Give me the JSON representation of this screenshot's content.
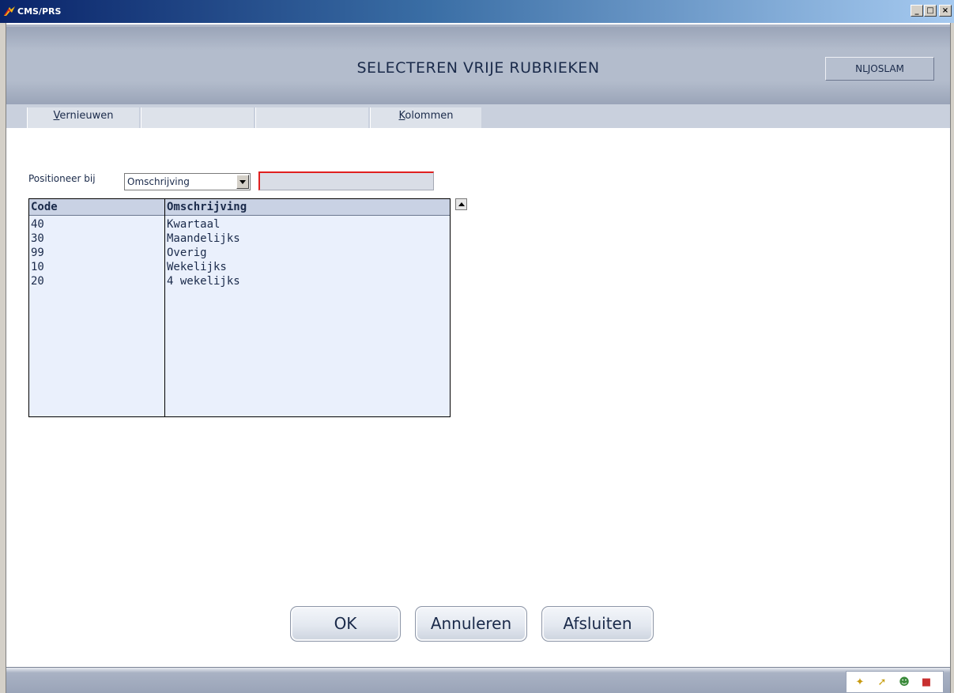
{
  "window": {
    "title": "CMS/PRS",
    "minimize_glyph": "_",
    "maximize_glyph": "□",
    "close_glyph": "×"
  },
  "header": {
    "title": "SELECTEREN VRIJE RUBRIEKEN",
    "user": "NLJOSLAM"
  },
  "menu": {
    "refresh": {
      "accel": "V",
      "rest": "ernieuwen"
    },
    "columns": {
      "accel": "K",
      "rest": "olommen"
    }
  },
  "position": {
    "label": "Positioneer bij",
    "selected": "Omschrijving",
    "search_value": ""
  },
  "grid": {
    "columns": [
      "Code",
      "Omschrijving"
    ],
    "rows": [
      {
        "code": "40",
        "desc": "Kwartaal"
      },
      {
        "code": "30",
        "desc": "Maandelijks"
      },
      {
        "code": "99",
        "desc": "Overig"
      },
      {
        "code": "10",
        "desc": "Wekelijks"
      },
      {
        "code": "20",
        "desc": "4 wekelijks"
      }
    ]
  },
  "buttons": {
    "ok": "OK",
    "cancel": "Annuleren",
    "close": "Afsluiten"
  },
  "tray": {
    "icons": [
      "hint-icon",
      "help-icon",
      "user-icon",
      "book-icon"
    ]
  },
  "colors": {
    "accent_red": "#e02020",
    "header_bg": "#b3bccc",
    "grid_bg": "#eaf0fc"
  }
}
